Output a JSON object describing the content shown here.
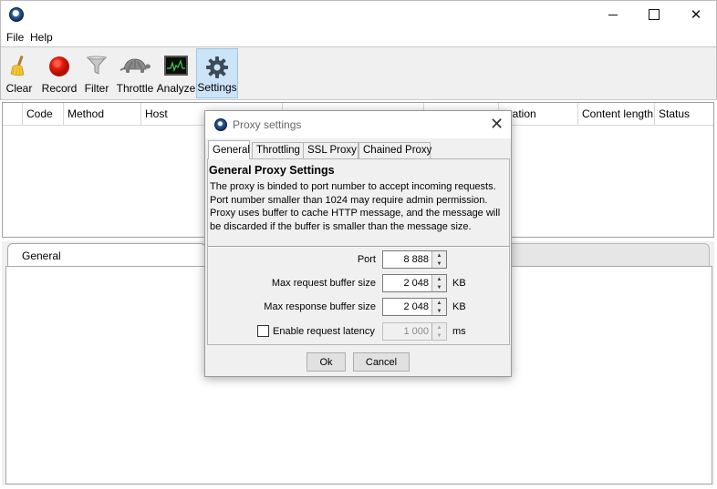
{
  "menu": {
    "file": "File",
    "help": "Help"
  },
  "toolbar": {
    "clear": "Clear",
    "record": "Record",
    "filter": "Filter",
    "throttle": "Throttle",
    "analyze": "Analyze",
    "settings": "Settings"
  },
  "table": {
    "columns": [
      "",
      "Code",
      "Method",
      "Host",
      "",
      "",
      "uration",
      "Content length",
      "Status"
    ]
  },
  "lower_panel": {
    "tab": "General"
  },
  "dialog": {
    "title": "Proxy settings",
    "tabs": [
      "General",
      "Throttling",
      "SSL Proxy",
      "Chained Proxy"
    ],
    "heading": "General Proxy Settings",
    "description": "The proxy is binded to port number to accept incoming requests. Port number smaller than 1024 may require admin permission. Proxy uses buffer to cache HTTP message, and the message will be discarded if the buffer is smaller than the message size.",
    "port_label": "Port",
    "port_value": "8 888",
    "req_buffer_label": "Max request buffer size",
    "req_buffer_value": "2 048",
    "req_buffer_unit": "KB",
    "resp_buffer_label": "Max response buffer size",
    "resp_buffer_value": "2 048",
    "resp_buffer_unit": "KB",
    "latency_label": "Enable request latency",
    "latency_value": "1 000",
    "latency_unit": "ms",
    "ok": "Ok",
    "cancel": "Cancel"
  },
  "icons": {
    "clear": "broom-icon",
    "record": "record-icon",
    "filter": "funnel-icon",
    "throttle": "turtle-icon",
    "analyze": "monitor-icon",
    "settings": "gear-icon"
  }
}
